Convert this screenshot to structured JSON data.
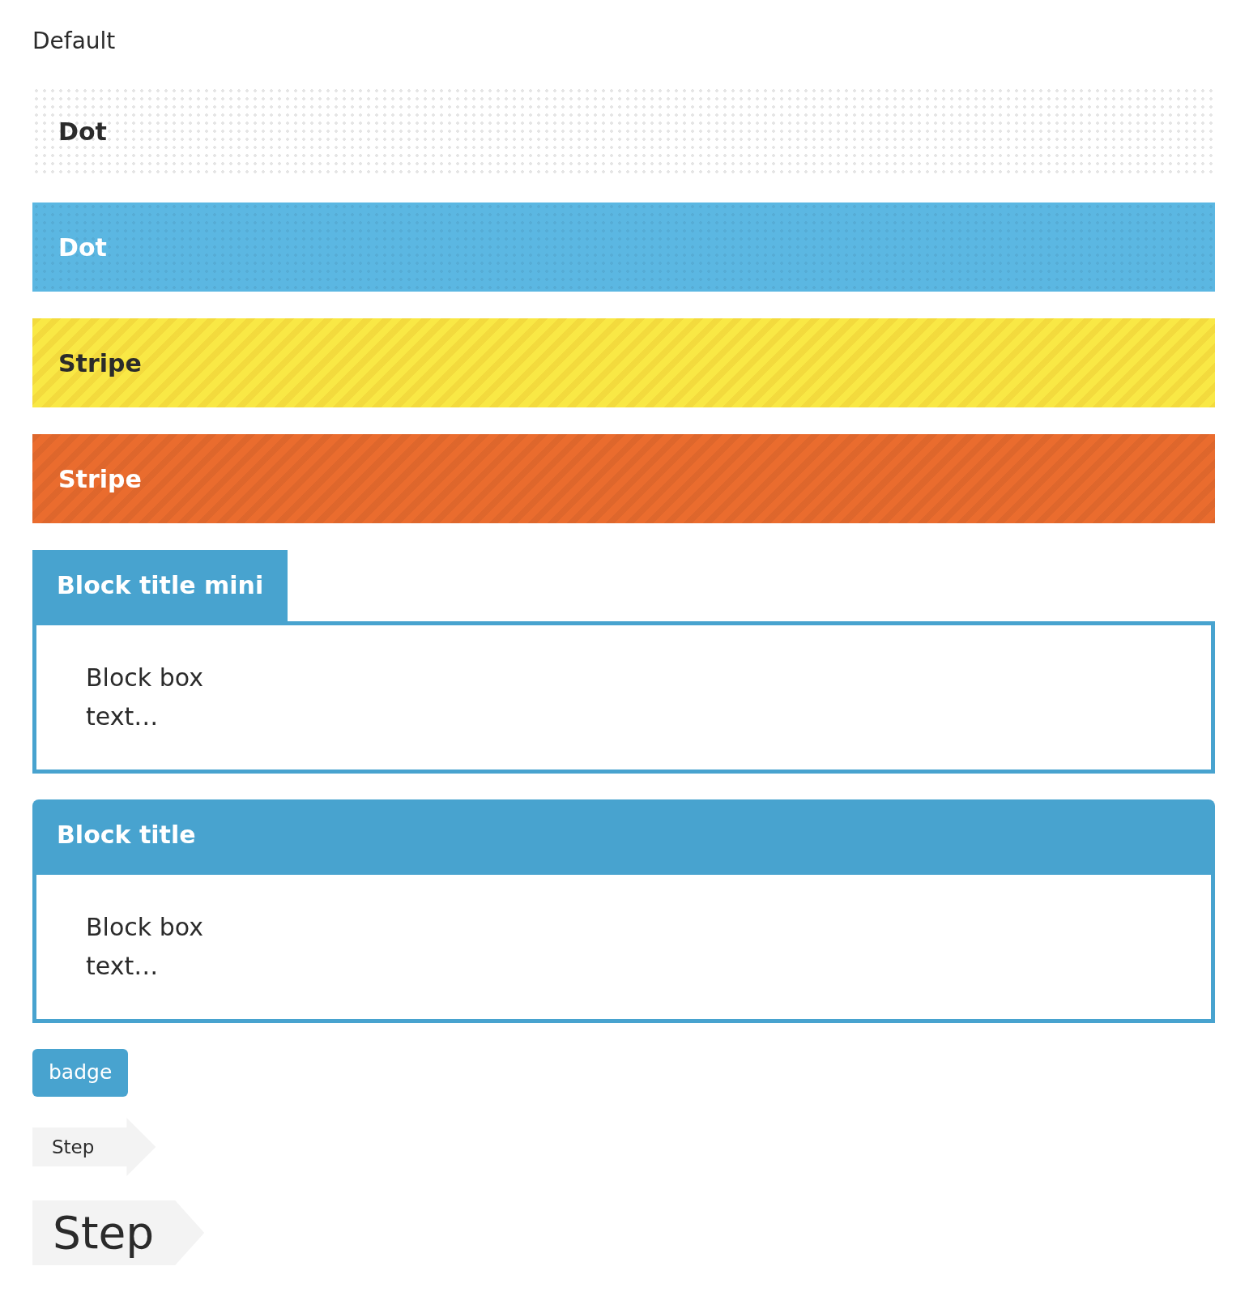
{
  "heading": "Default",
  "bars": [
    {
      "kind": "dot",
      "label": "Dot",
      "color": "#ffffff",
      "inverse": false
    },
    {
      "kind": "dot",
      "label": "Dot",
      "color": "#5bb7e2",
      "inverse": true
    },
    {
      "kind": "stripe",
      "label": "Stripe",
      "color": "#f9e845",
      "inverse": false
    },
    {
      "kind": "stripe",
      "label": "Stripe",
      "color": "#ea6c2e",
      "inverse": true
    }
  ],
  "blocks": [
    {
      "kind": "mini",
      "title": "Block title mini",
      "lines": [
        "Block box",
        "text…"
      ]
    },
    {
      "kind": "full",
      "title": "Block title",
      "lines": [
        "Block box",
        "text…"
      ]
    }
  ],
  "badge": "badge",
  "steps": [
    {
      "label": "Step",
      "kind": "small"
    },
    {
      "label": "Step",
      "kind": "large"
    }
  ]
}
